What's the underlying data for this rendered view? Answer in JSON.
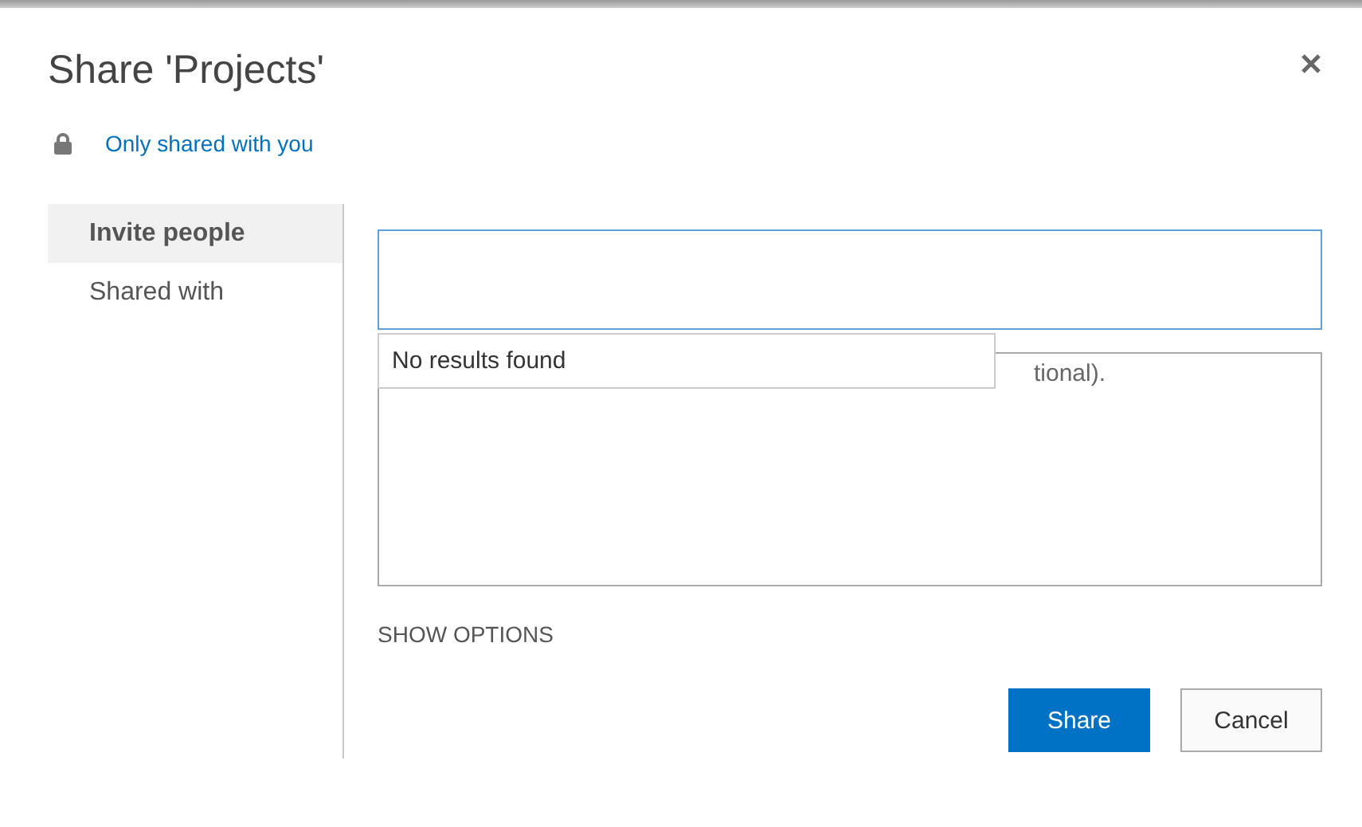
{
  "dialog": {
    "title": "Share 'Projects'"
  },
  "sharing_status": {
    "text": "Only shared with you"
  },
  "nav": [
    {
      "label": "Invite people",
      "selected": true
    },
    {
      "label": "Shared with",
      "selected": false
    }
  ],
  "suggestions": {
    "message": "No results found"
  },
  "message_field": {
    "visible_text": "tional)."
  },
  "show_options": "SHOW OPTIONS",
  "buttons": [
    {
      "label": "Share",
      "kind": "primary"
    },
    {
      "label": "Cancel",
      "kind": "secondary"
    }
  ]
}
